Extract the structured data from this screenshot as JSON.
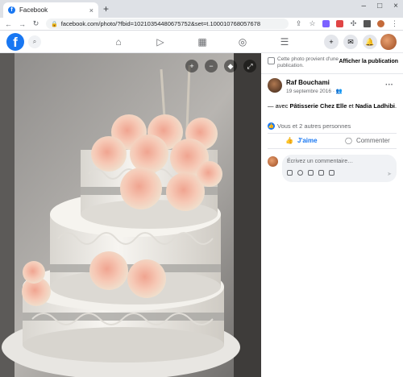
{
  "browser": {
    "tab_title": "Facebook",
    "tab_favicon": "f",
    "close_tab": "×",
    "new_tab": "+",
    "url": "facebook.com/photo/?fbid=10210354480675752&set=t.100010768057678",
    "minimize": "–",
    "maximize": "□",
    "close_window": "×"
  },
  "fb_header": {
    "logo": "f",
    "icons": [
      "search-icon",
      "home-icon",
      "watch-icon",
      "marketplace-icon",
      "groups-icon",
      "menu-icon",
      "create-icon",
      "messenger-icon",
      "notifications-icon"
    ],
    "brand_color": "#1877f2"
  },
  "photo_controls": [
    "zoom-in-icon",
    "zoom-out-icon",
    "tag-icon",
    "fullscreen-icon"
  ],
  "side": {
    "notice": "Cette photo provient d'une publication.",
    "show_publication": "Afficher la publication",
    "author": "Raf Bouchami",
    "date": "19 septembre 2016 · ",
    "privacy_glyph": "👥",
    "more": "···",
    "text_prefix": "— avec ",
    "tag1": "Pâtisserie Chez Elle",
    "text_mid": " et ",
    "tag2": "Nadia Ladhibi",
    "text_suffix": ".",
    "likes_text": "Vous et 2 autres personnes",
    "like_label": "J'aime",
    "comment_label": "Commenter",
    "comment_placeholder": "Écrivez un commentaire…"
  }
}
